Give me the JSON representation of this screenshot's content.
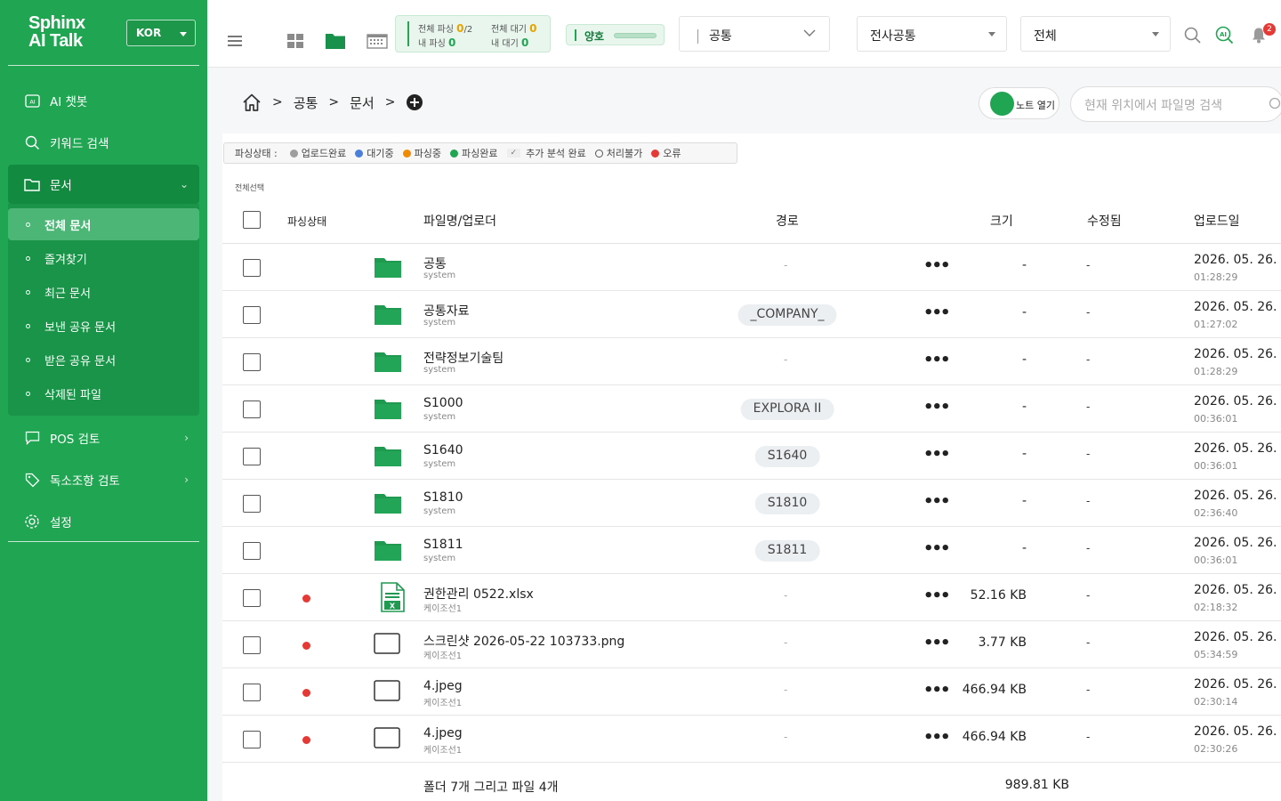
{
  "sidebar": {
    "brand_line1": "Sphinx",
    "brand_line2": "AI Talk",
    "language": "KOR",
    "nav": {
      "ai_chatbot": "AI 챗봇",
      "keyword_search": "키워드 검색",
      "documents": "문서",
      "pos_review": "POS 검토",
      "toxic_review": "독소조항 검토",
      "settings": "설정"
    },
    "submenu": [
      "전체 문서",
      "즐겨찾기",
      "최근 문서",
      "보낸 공유 문서",
      "받은 공유 문서",
      "삭제된 파일"
    ]
  },
  "topbar": {
    "parse": {
      "total_parse_label": "전체 파싱",
      "total_parse_value": "0",
      "total_parse_max": "/2",
      "total_wait_label": "전체 대기",
      "total_wait_value": "0",
      "my_parse_label": "내 파싱",
      "my_parse_value": "0",
      "my_wait_label": "내 대기",
      "my_wait_value": "0"
    },
    "status_label": "양호",
    "dropdown_path": "공통",
    "dropdown_scope": "전사공통",
    "dropdown_filter": "전체",
    "notification_count": "2"
  },
  "breadcrumb": [
    "공통",
    "문서"
  ],
  "note_toggle_label": "노트 열기",
  "search_placeholder": "현재 위치에서 파일명 검색",
  "legend": {
    "title": "파싱상태 :",
    "items": [
      {
        "label": "업로드완료",
        "color": "#9e9e9e"
      },
      {
        "label": "대기중",
        "color": "#4a7fdc"
      },
      {
        "label": "파싱중",
        "color": "#f08a00"
      },
      {
        "label": "파싱완료",
        "color": "#20a552"
      },
      {
        "label": "추가 분석 완료",
        "color": "check"
      },
      {
        "label": "처리불가",
        "color": "ring"
      },
      {
        "label": "오류",
        "color": "#e53935"
      }
    ]
  },
  "table": {
    "select_all_label": "전체선택",
    "headers": {
      "status": "파싱상태",
      "name": "파일명/업로더",
      "path": "경로",
      "size": "크기",
      "modified": "수정됨",
      "uploaded": "업로드일"
    },
    "rows": [
      {
        "type": "folder",
        "name": "공통",
        "uploader": "system",
        "path": "-",
        "size": "-",
        "modified": "-",
        "date": "2026. 05. 26.",
        "time": "01:28:29",
        "status": ""
      },
      {
        "type": "folder",
        "name": "공통자료",
        "uploader": "system",
        "path": "_COMPANY_",
        "size": "-",
        "modified": "-",
        "date": "2026. 05. 26.",
        "time": "01:27:02",
        "status": ""
      },
      {
        "type": "folder",
        "name": "전략정보기술팀",
        "uploader": "system",
        "path": "-",
        "size": "-",
        "modified": "-",
        "date": "2026. 05. 26.",
        "time": "01:28:29",
        "status": ""
      },
      {
        "type": "folder",
        "name": "S1000",
        "uploader": "system",
        "path": "EXPLORA II",
        "size": "-",
        "modified": "-",
        "date": "2026. 05. 26.",
        "time": "00:36:01",
        "status": ""
      },
      {
        "type": "folder",
        "name": "S1640",
        "uploader": "system",
        "path": "S1640",
        "size": "-",
        "modified": "-",
        "date": "2026. 05. 26.",
        "time": "00:36:01",
        "status": ""
      },
      {
        "type": "folder",
        "name": "S1810",
        "uploader": "system",
        "path": "S1810",
        "size": "-",
        "modified": "-",
        "date": "2026. 05. 26.",
        "time": "02:36:40",
        "status": ""
      },
      {
        "type": "folder",
        "name": "S1811",
        "uploader": "system",
        "path": "S1811",
        "size": "-",
        "modified": "-",
        "date": "2026. 05. 26.",
        "time": "00:36:01",
        "status": ""
      },
      {
        "type": "xlsx",
        "name": "권한관리 0522.xlsx",
        "uploader": "케이조선1",
        "path": "-",
        "size": "52.16 KB",
        "modified": "-",
        "date": "2026. 05. 26.",
        "time": "02:18:32",
        "status": "error"
      },
      {
        "type": "image",
        "name": "스크린샷 2026-05-22 103733.png",
        "uploader": "케이조선1",
        "path": "-",
        "size": "3.77 KB",
        "modified": "-",
        "date": "2026. 05. 26.",
        "time": "05:34:59",
        "status": "error"
      },
      {
        "type": "image",
        "name": "4.jpeg",
        "uploader": "케이조선1",
        "path": "-",
        "size": "466.94 KB",
        "modified": "-",
        "date": "2026. 05. 26.",
        "time": "02:30:14",
        "status": "error"
      },
      {
        "type": "image",
        "name": "4.jpeg",
        "uploader": "케이조선1",
        "path": "-",
        "size": "466.94 KB",
        "modified": "-",
        "date": "2026. 05. 26.",
        "time": "02:30:26",
        "status": "error"
      }
    ],
    "footer_summary": "폴더 7개 그리고 파일 4개",
    "footer_total_size": "989.81 KB"
  },
  "colors": {
    "brand_green": "#20a552",
    "error_red": "#e53935"
  }
}
